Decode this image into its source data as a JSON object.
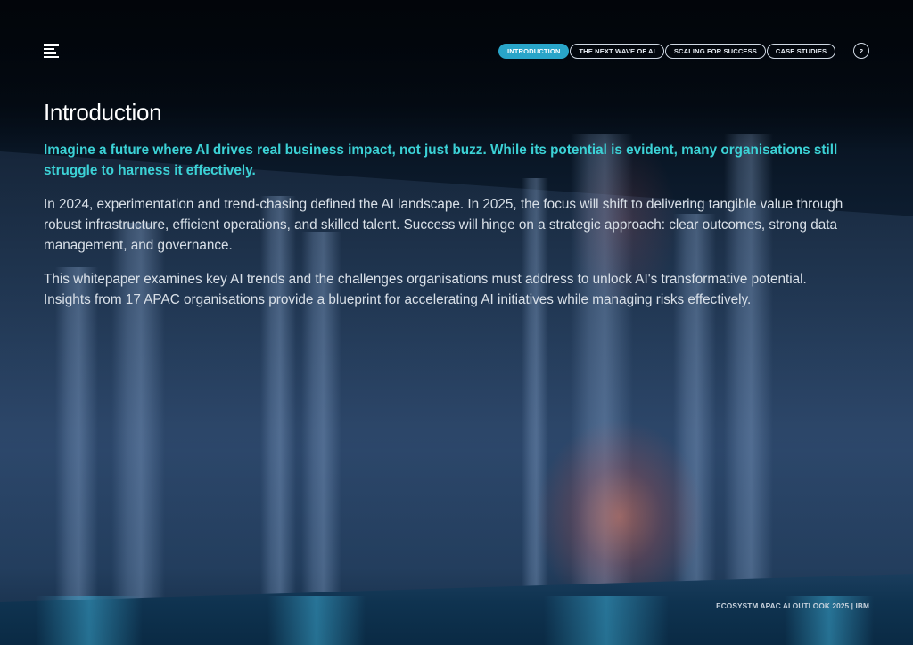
{
  "header": {
    "logo": "ecosystm-logo-icon",
    "nav": [
      {
        "label": "INTRODUCTION",
        "active": true
      },
      {
        "label": "THE NEXT WAVE OF AI",
        "active": false
      },
      {
        "label": "SCALING FOR SUCCESS",
        "active": false
      },
      {
        "label": "CASE STUDIES",
        "active": false
      }
    ],
    "page_number": "2"
  },
  "main": {
    "title": "Introduction",
    "lead": "Imagine a future where AI drives real business impact, not just buzz. While its potential is evident, many organisations still struggle to harness it effectively.",
    "paragraphs": [
      "In 2024, experimentation and trend-chasing defined the AI landscape. In 2025, the focus will shift to delivering tangible value through robust infrastructure, efficient operations, and skilled talent. Success will hinge on a strategic approach: clear outcomes, strong data management, and governance.",
      "This whitepaper examines key AI trends and the challenges organisations must address to unlock AI's transformative potential. Insights from 17 APAC organisations provide a blueprint for accelerating AI initiatives while managing risks effectively."
    ]
  },
  "footer": {
    "text": "ECOSYSTM APAC AI OUTLOOK 2025 | IBM"
  },
  "colors": {
    "accent": "#3cd2d6",
    "nav_active": "#29a5c9",
    "background": "#050b14"
  }
}
